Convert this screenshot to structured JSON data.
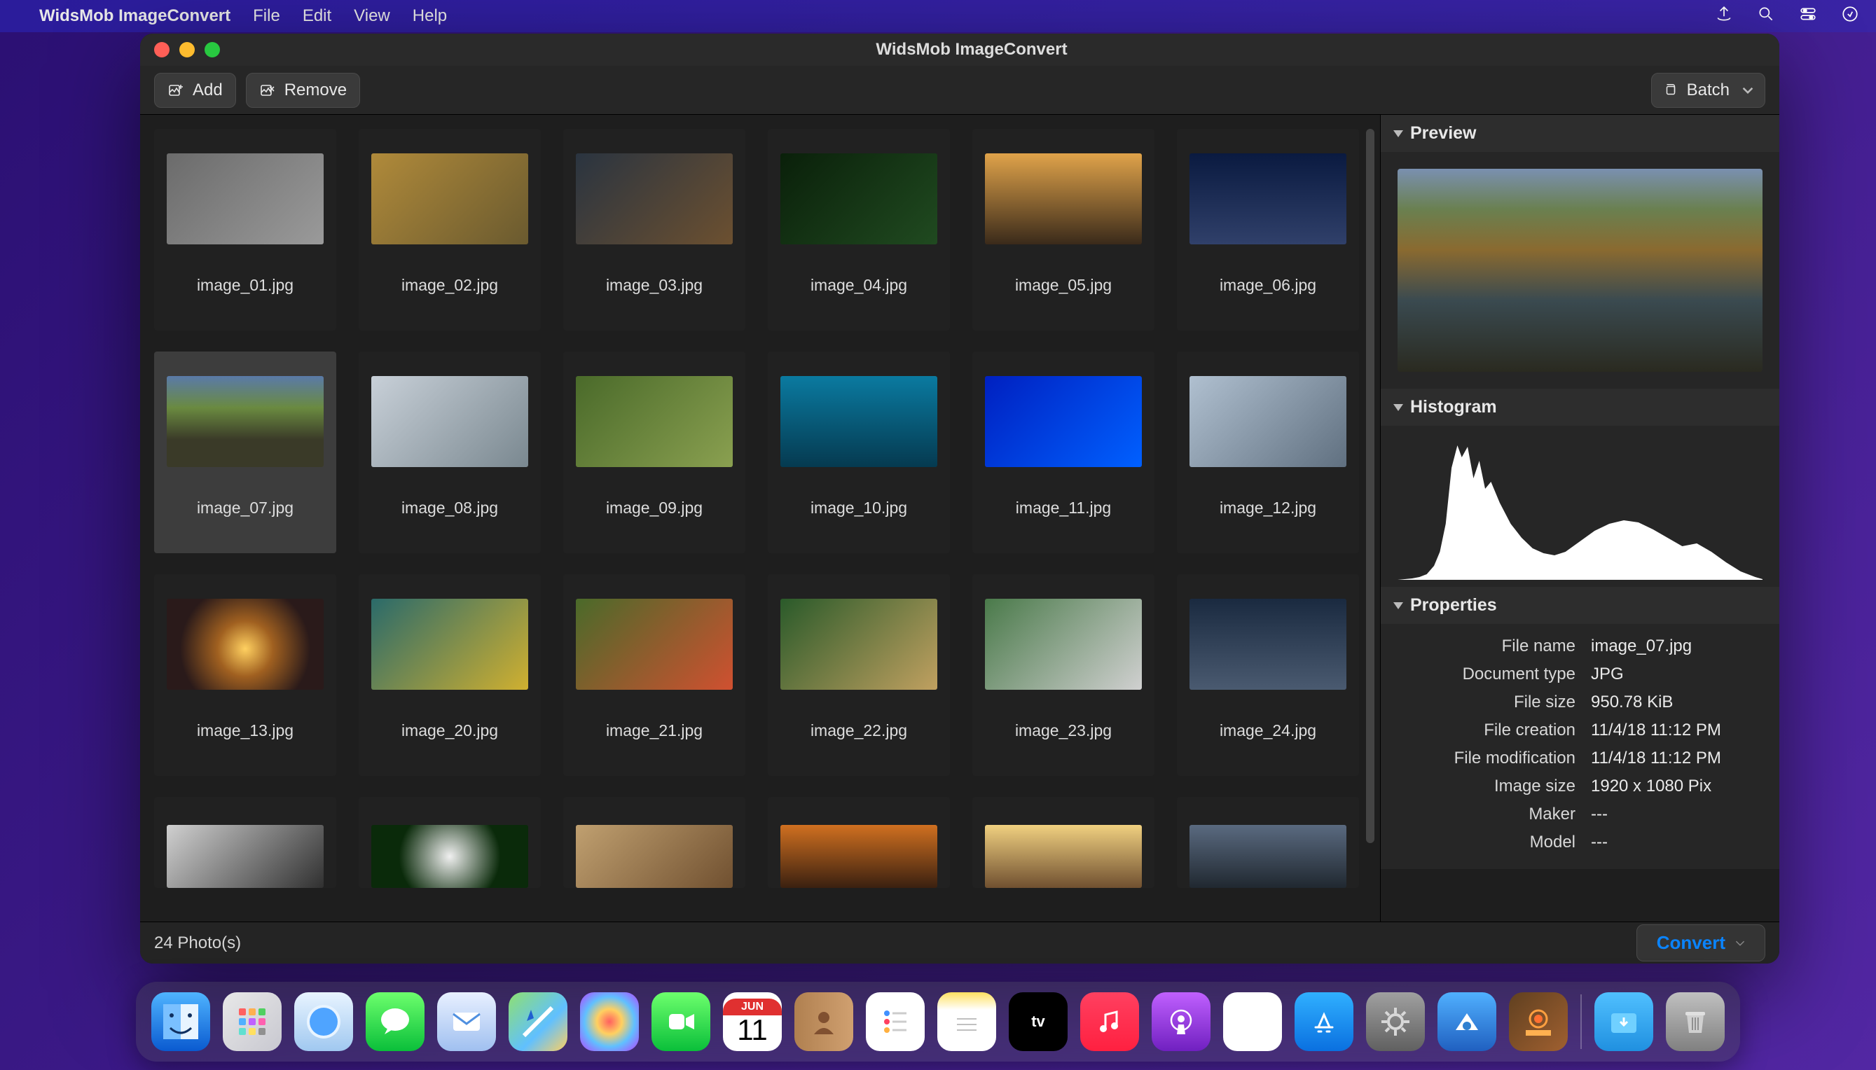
{
  "menubar": {
    "app_name": "WidsMob ImageConvert",
    "items": [
      "File",
      "Edit",
      "View",
      "Help"
    ]
  },
  "window": {
    "title": "WidsMob ImageConvert",
    "toolbar": {
      "add_label": "Add",
      "remove_label": "Remove",
      "batch_label": "Batch"
    },
    "status": "24 Photo(s)",
    "convert_label": "Convert"
  },
  "thumbs": [
    {
      "label": "image_01.jpg",
      "cls": "g-cat"
    },
    {
      "label": "image_02.jpg",
      "cls": "g-car"
    },
    {
      "label": "image_03.jpg",
      "cls": "g-fig"
    },
    {
      "label": "image_04.jpg",
      "cls": "g-macro"
    },
    {
      "label": "image_05.jpg",
      "cls": "g-city1"
    },
    {
      "label": "image_06.jpg",
      "cls": "g-city2"
    },
    {
      "label": "image_07.jpg",
      "cls": "g-lake",
      "selected": true
    },
    {
      "label": "image_08.jpg",
      "cls": "g-jet"
    },
    {
      "label": "image_09.jpg",
      "cls": "g-owl"
    },
    {
      "label": "image_10.jpg",
      "cls": "g-rocket"
    },
    {
      "label": "image_11.jpg",
      "cls": "g-wave"
    },
    {
      "label": "image_12.jpg",
      "cls": "g-tank"
    },
    {
      "label": "image_13.jpg",
      "cls": "g-sun"
    },
    {
      "label": "image_20.jpg",
      "cls": "g-port"
    },
    {
      "label": "image_21.jpg",
      "cls": "g-red"
    },
    {
      "label": "image_22.jpg",
      "cls": "g-leo"
    },
    {
      "label": "image_23.jpg",
      "cls": "g-cat2"
    },
    {
      "label": "image_24.jpg",
      "cls": "g-river"
    }
  ],
  "thumbs_partial": [
    {
      "cls": "g-bw"
    },
    {
      "cls": "g-flower"
    },
    {
      "cls": "g-dog"
    },
    {
      "cls": "g-orange"
    },
    {
      "cls": "g-dog2"
    },
    {
      "cls": "g-storm"
    }
  ],
  "sidebar": {
    "preview_title": "Preview",
    "histogram_title": "Histogram",
    "properties_title": "Properties",
    "props": [
      {
        "label": "File name",
        "value": "image_07.jpg"
      },
      {
        "label": "Document type",
        "value": "JPG"
      },
      {
        "label": "File size",
        "value": "950.78 KiB"
      },
      {
        "label": "File creation",
        "value": "11/4/18 11:12 PM"
      },
      {
        "label": "File modification",
        "value": "11/4/18 11:12 PM"
      },
      {
        "label": "Image size",
        "value": "1920 x 1080 Pix"
      },
      {
        "label": "Maker",
        "value": "---"
      },
      {
        "label": "Model",
        "value": "---"
      }
    ]
  },
  "dock": {
    "calendar": {
      "month": "JUN",
      "day": "11"
    }
  }
}
